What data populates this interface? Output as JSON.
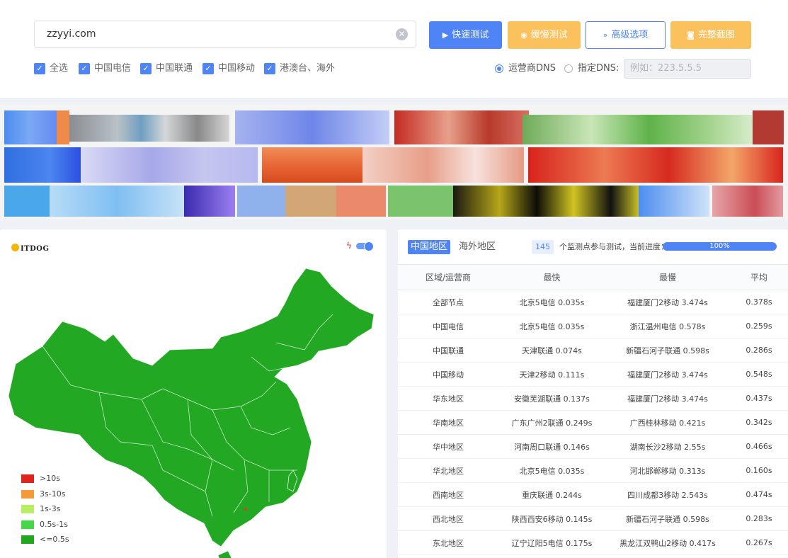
{
  "search": {
    "value": "zzyyi.com",
    "clear_icon": "clear-icon"
  },
  "buttons": {
    "fast": "快速测试",
    "slow": "缓慢测试",
    "advanced": "高级选项",
    "screenshot": "完整截图"
  },
  "isp_filters": [
    {
      "label": "全选",
      "checked": true
    },
    {
      "label": "中国电信",
      "checked": true
    },
    {
      "label": "中国联通",
      "checked": true
    },
    {
      "label": "中国移动",
      "checked": true
    },
    {
      "label": "港澳台、海外",
      "checked": true
    }
  ],
  "dns": {
    "operator_label": "运营商DNS",
    "custom_label": "指定DNS:",
    "selected": "operator",
    "custom_placeholder": "例如：223.5.5.5"
  },
  "map": {
    "logo_text": "ITDOG",
    "toggle_on": true,
    "fill_color": "#22a822",
    "legend": [
      {
        "label": ">10s",
        "color": "#e0231c"
      },
      {
        "label": "3s-10s",
        "color": "#f49a37"
      },
      {
        "label": "1s-3s",
        "color": "#b9ee62"
      },
      {
        "label": "0.5s-1s",
        "color": "#45d846"
      },
      {
        "label": "<=0.5s",
        "color": "#23a720"
      }
    ]
  },
  "stats": {
    "tab_china": "中国地区",
    "tab_overseas": "海外地区",
    "node_count": "145",
    "node_text": "个监测点参与测试，当前进度：",
    "progress": "100%",
    "columns": [
      "区域/运营商",
      "最快",
      "最慢",
      "平均"
    ],
    "rows": [
      [
        "全部节点",
        "北京5电信 0.035s",
        "福建厦门2移动 3.474s",
        "0.378s"
      ],
      [
        "中国电信",
        "北京5电信 0.035s",
        "浙江温州电信 0.578s",
        "0.259s"
      ],
      [
        "中国联通",
        "天津联通 0.074s",
        "新疆石河子联通 0.598s",
        "0.286s"
      ],
      [
        "中国移动",
        "天津2移动 0.111s",
        "福建厦门2移动 3.474s",
        "0.548s"
      ],
      [
        "华东地区",
        "安徽芜湖联通 0.137s",
        "福建厦门2移动 3.474s",
        "0.437s"
      ],
      [
        "华南地区",
        "广东广州2联通 0.249s",
        "广西桂林移动 0.421s",
        "0.342s"
      ],
      [
        "华中地区",
        "河南周口联通 0.146s",
        "湖南长沙2移动 2.55s",
        "0.466s"
      ],
      [
        "华北地区",
        "北京5电信 0.035s",
        "河北邯郸移动 0.313s",
        "0.160s"
      ],
      [
        "西南地区",
        "重庆联通 0.244s",
        "四川成都3移动 2.543s",
        "0.474s"
      ],
      [
        "西北地区",
        "陕西西安6移动 0.145s",
        "新疆石河子联通 0.598s",
        "0.283s"
      ],
      [
        "东北地区",
        "辽宁辽阳5电信 0.175s",
        "黑龙江双鸭山2移动 0.417s",
        "0.267s"
      ]
    ]
  }
}
